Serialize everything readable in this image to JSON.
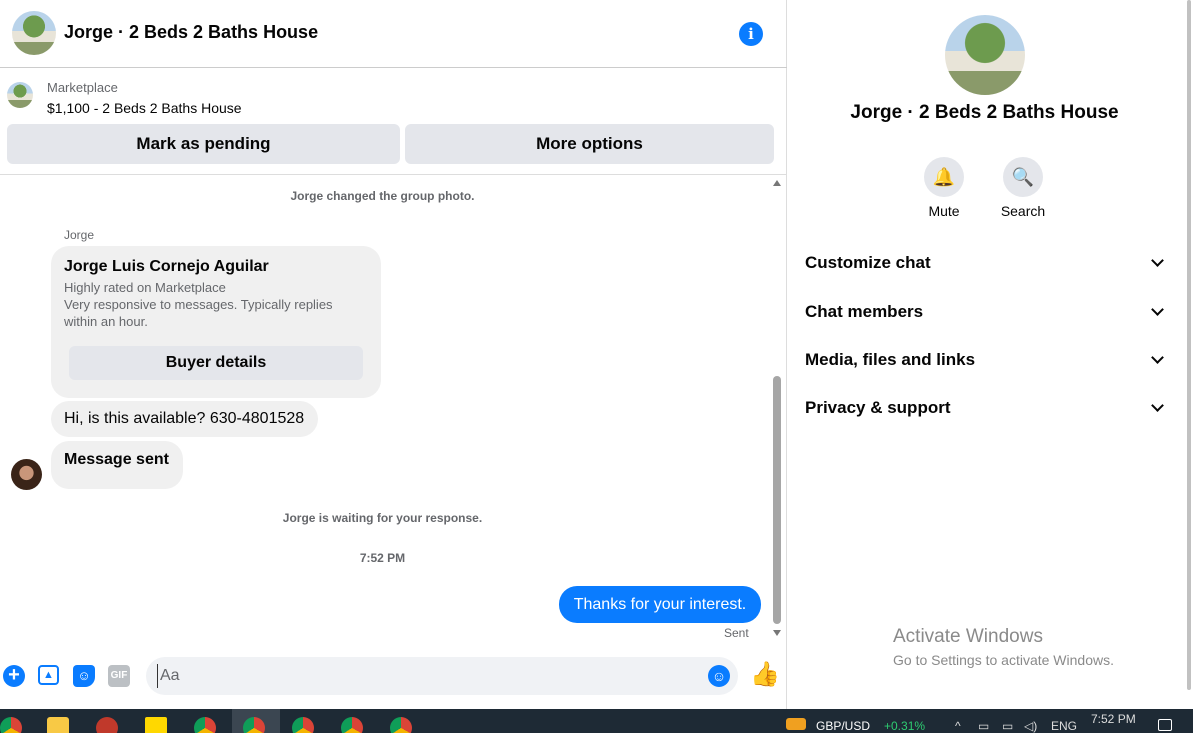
{
  "header": {
    "title": "Jorge · 2 Beds 2 Baths House"
  },
  "marketplace": {
    "label": "Marketplace",
    "listing": "$1,100 - 2 Beds 2 Baths House",
    "pending_label": "Mark as pending",
    "more_label": "More options"
  },
  "chat": {
    "system1": "Jorge changed the group photo.",
    "sender": "Jorge",
    "card": {
      "name": "Jorge Luis Cornejo Aguilar",
      "line1": "Highly rated on Marketplace",
      "line2": "Very responsive to messages. Typically replies within an hour.",
      "button": "Buyer details"
    },
    "msg1": "Hi, is this available? 630-4801528",
    "msg2": "Message sent",
    "system2": "Jorge is waiting for your response.",
    "time": "7:52 PM",
    "out_msg": "Thanks for your interest.",
    "status": "Sent"
  },
  "composer": {
    "placeholder": "Aa",
    "gif_label": "GIF"
  },
  "panel": {
    "title": "Jorge · 2 Beds 2 Baths House",
    "mute_label": "Mute",
    "search_label": "Search",
    "rows": [
      "Customize chat",
      "Chat members",
      "Media, files and links",
      "Privacy & support"
    ]
  },
  "watermark": {
    "line1": "Activate Windows",
    "line2": "Go to Settings to activate Windows."
  },
  "taskbar": {
    "pair": "GBP/USD",
    "change": "+0.31%",
    "lang": "ENG",
    "clock": "7:52 PM"
  },
  "colors": {
    "accent": "#0a7cff",
    "bubble_in": "#f0f0f0",
    "taskbar": "#1e2a35"
  }
}
